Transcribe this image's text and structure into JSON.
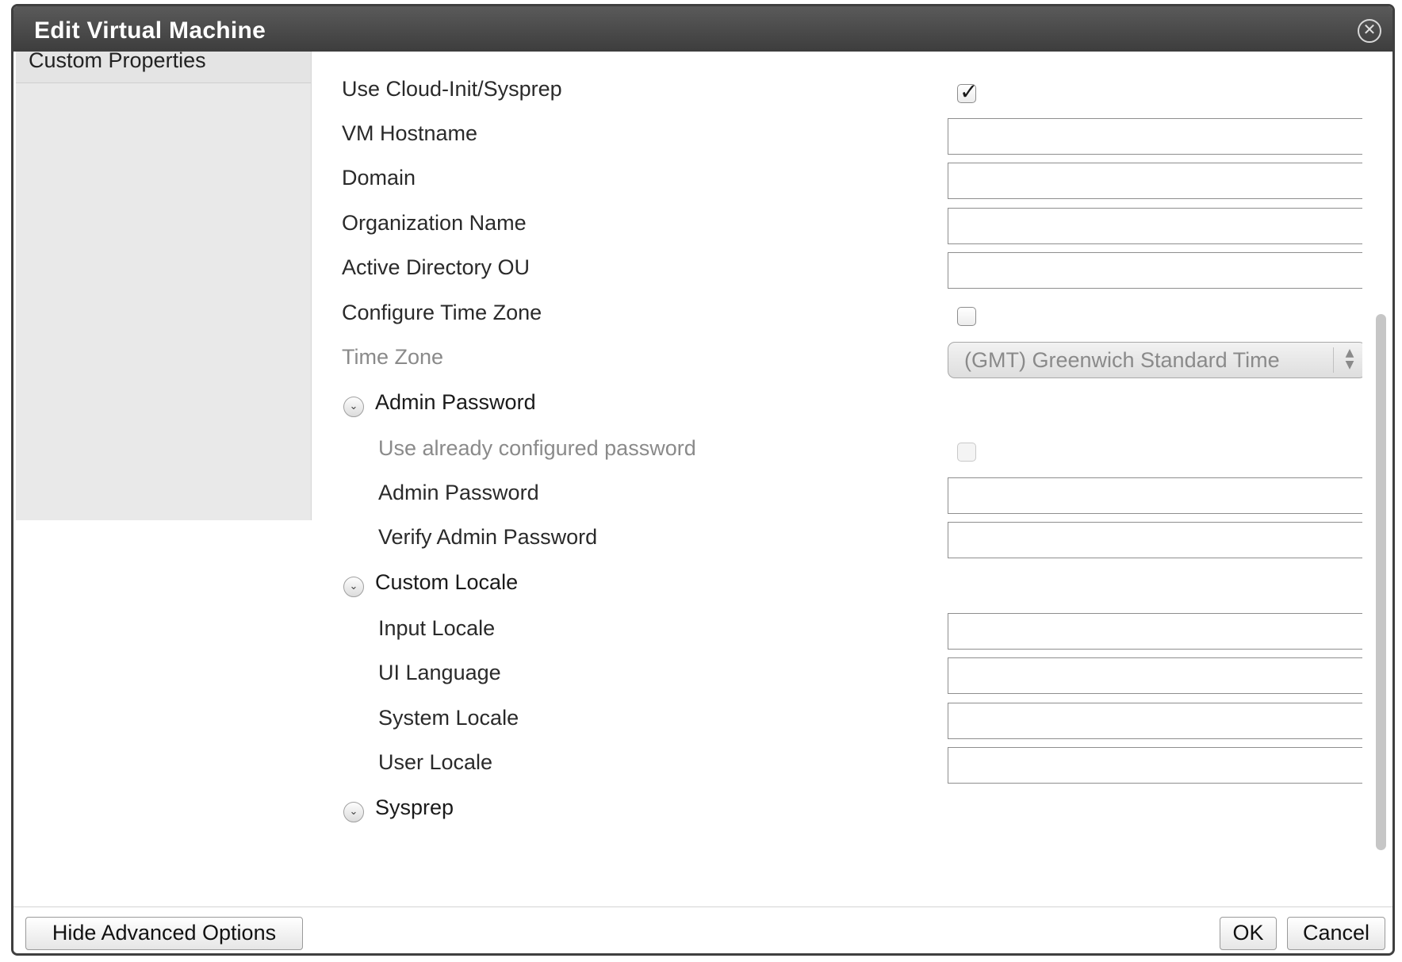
{
  "dialog": {
    "title": "Edit Virtual Machine",
    "close_icon": "close-circle-icon"
  },
  "sidebar": {
    "items": [
      {
        "label": "Custom Properties"
      }
    ]
  },
  "form": {
    "use_cloud_init": {
      "label": "Use Cloud-Init/Sysprep",
      "checked": true
    },
    "vm_hostname": {
      "label": "VM Hostname",
      "value": ""
    },
    "domain": {
      "label": "Domain",
      "value": ""
    },
    "organization_name": {
      "label": "Organization Name",
      "value": ""
    },
    "ad_ou": {
      "label": "Active Directory OU",
      "value": ""
    },
    "configure_time_zone": {
      "label": "Configure Time Zone",
      "checked": false
    },
    "time_zone": {
      "label": "Time Zone",
      "value": "(GMT) Greenwich Standard Time",
      "enabled": false
    },
    "admin_password_section": {
      "label": "Admin Password",
      "expanded": true,
      "use_configured": {
        "label": "Use already configured password",
        "checked": false,
        "enabled": false
      },
      "admin_password": {
        "label": "Admin Password",
        "value": ""
      },
      "verify_admin_password": {
        "label": "Verify Admin Password",
        "value": ""
      }
    },
    "custom_locale_section": {
      "label": "Custom Locale",
      "expanded": true,
      "input_locale": {
        "label": "Input Locale",
        "value": ""
      },
      "ui_language": {
        "label": "UI Language",
        "value": ""
      },
      "system_locale": {
        "label": "System Locale",
        "value": ""
      },
      "user_locale": {
        "label": "User Locale",
        "value": ""
      }
    },
    "sysprep_section": {
      "label": "Sysprep",
      "expanded": true
    }
  },
  "footer": {
    "hide_advanced_label": "Hide Advanced Options",
    "ok_label": "OK",
    "cancel_label": "Cancel"
  }
}
